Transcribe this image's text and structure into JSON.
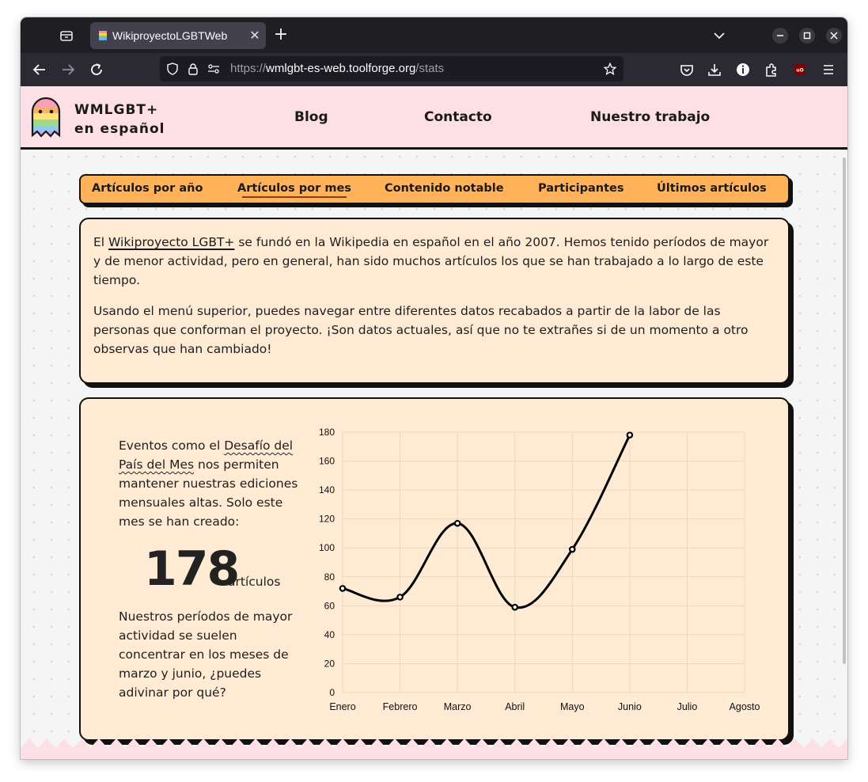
{
  "browser": {
    "tab_title": "WikiproyectoLGBTWeb",
    "url_scheme": "https://",
    "url_host": "wmlgbt-es-web.toolforge.org",
    "url_path": "/stats"
  },
  "site": {
    "brand_line1": "WMLGBT+",
    "brand_line2": "en español",
    "nav": [
      "Blog",
      "Contacto",
      "Nuestro trabajo"
    ],
    "subnav": [
      "Artículos por año",
      "Artículos por mes",
      "Contenido notable",
      "Participantes",
      "Últimos artículos"
    ],
    "subnav_active": "Artículos por mes"
  },
  "intro": {
    "p1_before": "El ",
    "p1_link": "Wikiproyecto LGBT+",
    "p1_after": " se fundó en la Wikipedia en español en el año 2007. Hemos tenido períodos de mayor y de menor actividad, pero en general, han sido muchos artículos los que se han trabajado a lo largo de este tiempo.",
    "p2": "Usando el menú superior, puedes navegar entre diferentes datos recabados a partir de la labor de las personas que conforman el proyecto. ¡Son datos actuales, así que no te extrañes si de un momento a otro observas que han cambiado!"
  },
  "stats": {
    "text_before": "Eventos como el ",
    "text_link": "Desafío del País del Mes",
    "text_after": " nos permiten mantener nuestras ediciones mensuales altas. Solo este mes se han creado:",
    "count": "178",
    "count_unit": "artículos",
    "footer_text": "Nuestros períodos de mayor actividad se suelen concentrar en los meses de marzo y junio, ¿puedes adivinar por qué?"
  },
  "chart_data": {
    "type": "line",
    "categories": [
      "Enero",
      "Febrero",
      "Marzo",
      "Abril",
      "Mayo",
      "Junio",
      "Julio",
      "Agosto"
    ],
    "values": [
      72,
      66,
      117,
      59,
      99,
      178,
      null,
      null
    ],
    "ylim": [
      0,
      180
    ],
    "yticks": [
      0,
      20,
      40,
      60,
      80,
      100,
      120,
      140,
      160,
      180
    ],
    "grid": true,
    "line_color": "#000000",
    "grid_color": "#ead8bf"
  },
  "colors": {
    "header_bg": "#fde0e6",
    "subnav_bg": "#ffb25a",
    "card_bg": "#ffebd4"
  }
}
